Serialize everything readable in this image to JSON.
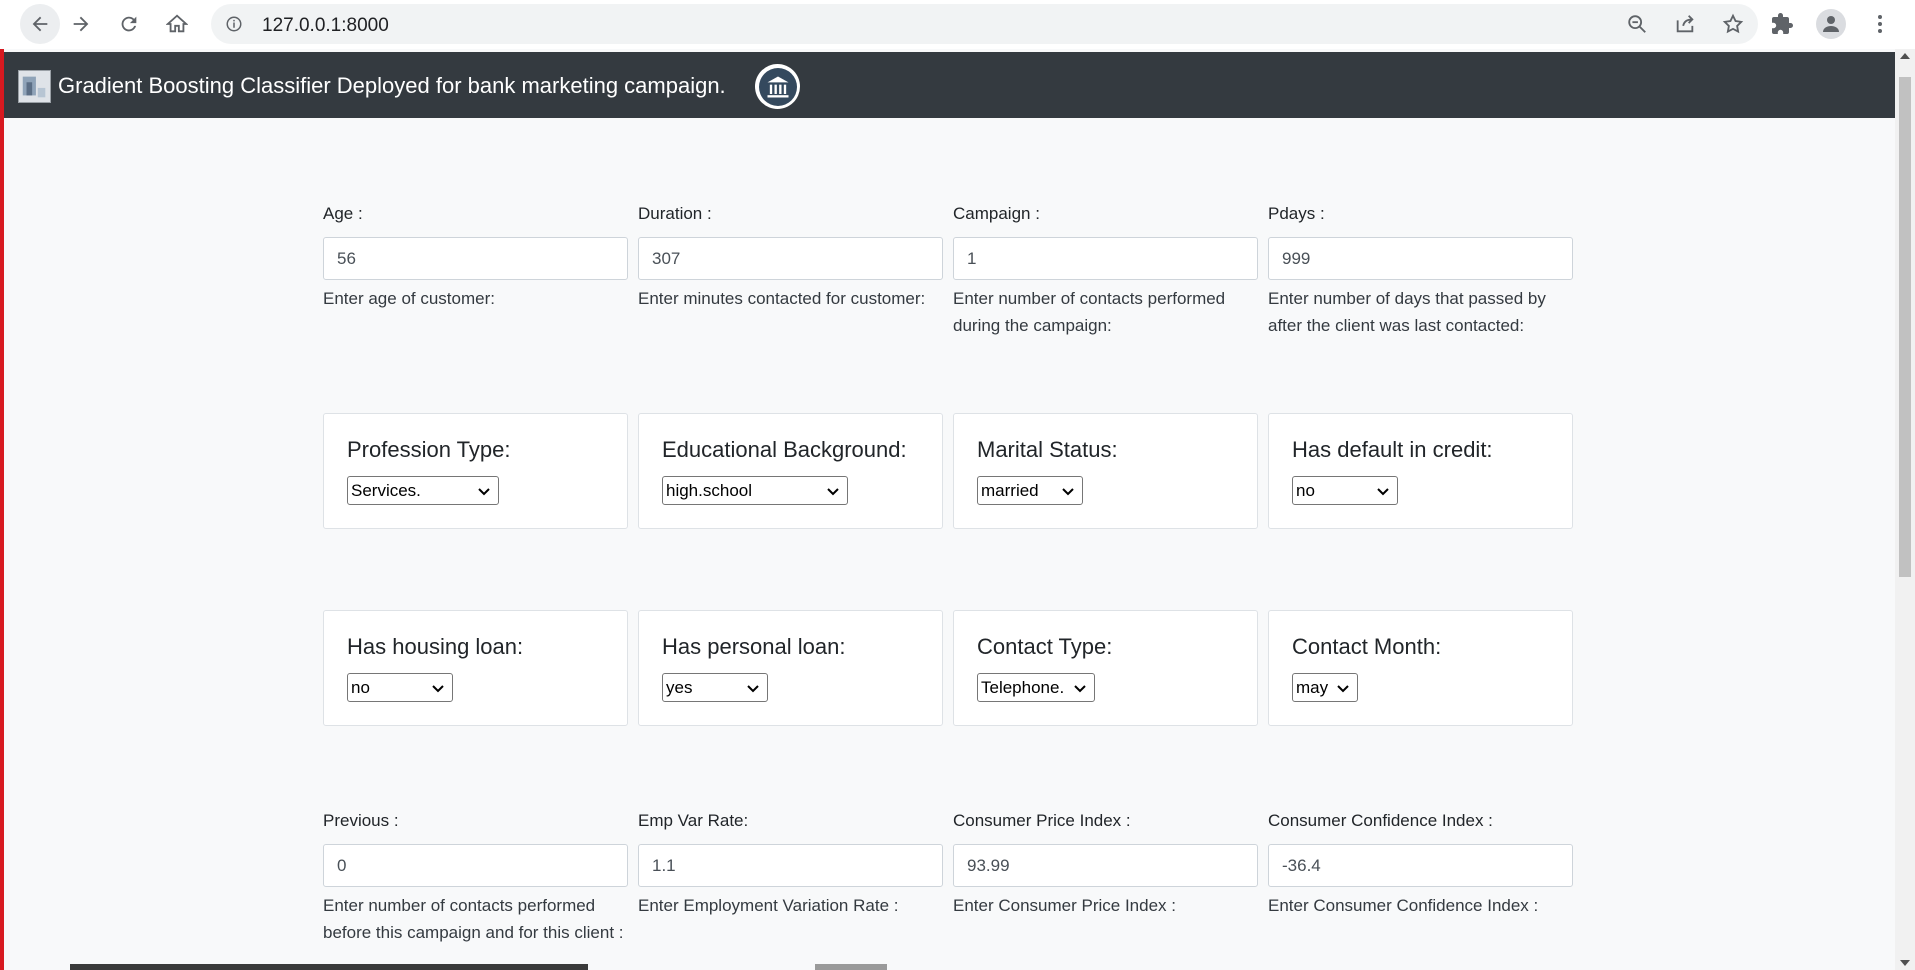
{
  "browser": {
    "url": "127.0.0.1:8000"
  },
  "navbar": {
    "brand": "Gradient Boosting Classifier Deployed for bank marketing campaign."
  },
  "inputs_row1": [
    {
      "label": "Age :",
      "value": "56",
      "help": "Enter age of customer:"
    },
    {
      "label": "Duration :",
      "value": "307",
      "help": "Enter minutes contacted for customer:"
    },
    {
      "label": "Campaign :",
      "value": "1",
      "help": "Enter number of contacts performed during the campaign:"
    },
    {
      "label": "Pdays :",
      "value": "999",
      "help": "Enter number of days that passed by after the client was last contacted:"
    }
  ],
  "selects_row1": [
    {
      "title": "Profession Type:",
      "selected": "Services."
    },
    {
      "title": "Educational Background:",
      "selected": "high.school"
    },
    {
      "title": "Marital Status:",
      "selected": "married"
    },
    {
      "title": "Has default in credit:",
      "selected": "no"
    }
  ],
  "selects_row2": [
    {
      "title": "Has housing loan:",
      "selected": "no"
    },
    {
      "title": "Has personal loan:",
      "selected": "yes"
    },
    {
      "title": "Contact Type:",
      "selected": "Telephone."
    },
    {
      "title": "Contact Month:",
      "selected": "may"
    }
  ],
  "inputs_row2": [
    {
      "label": "Previous :",
      "value": "0",
      "help": "Enter number of contacts performed before this campaign and for this client :"
    },
    {
      "label": "Emp Var Rate:",
      "value": "1.1",
      "help": "Enter Employment Variation Rate :"
    },
    {
      "label": "Consumer Price Index :",
      "value": "93.99",
      "help": "Enter Consumer Price Index :"
    },
    {
      "label": "Consumer Confidence Index :",
      "value": "-36.4",
      "help": "Enter Consumer Confidence Index :"
    }
  ],
  "colors": {
    "navbar_bg": "#343a40",
    "page_bg": "#f8f9fa",
    "left_edge": "#d71920"
  }
}
